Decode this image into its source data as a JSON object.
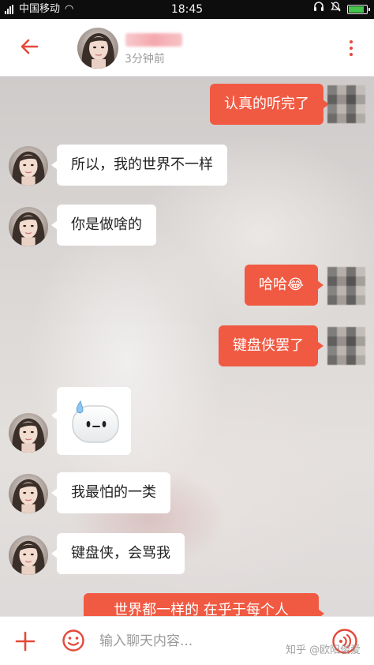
{
  "status_bar": {
    "carrier": "中国移动",
    "time": "18:45",
    "battery_level": 0.9
  },
  "header": {
    "contact_status": "3分钟前",
    "back_icon": "arrow-left-icon",
    "more_icon": "more-vertical-icon"
  },
  "messages": [
    {
      "side": "right",
      "text": "认真的听完了"
    },
    {
      "side": "left",
      "text": "所以，我的世界不一样"
    },
    {
      "side": "left",
      "text": "你是做啥的"
    },
    {
      "side": "right",
      "text": "哈哈😂"
    },
    {
      "side": "right",
      "text": "键盘侠罢了"
    },
    {
      "side": "left",
      "sticker": "sweat-face-sticker"
    },
    {
      "side": "left",
      "text": "我最怕的一类"
    },
    {
      "side": "left",
      "text": "键盘侠，会骂我"
    },
    {
      "side": "right",
      "text": "世界都一样的 在乎于每个人"
    }
  ],
  "input_bar": {
    "placeholder": "输入聊天内容...",
    "plus_icon": "plus-icon",
    "emoji_icon": "emoji-icon",
    "voice_icon": "voice-icon"
  },
  "watermark": "知乎 @欧阳俊爱",
  "colors": {
    "accent": "#f05a42",
    "icon_red": "#e3493a"
  }
}
